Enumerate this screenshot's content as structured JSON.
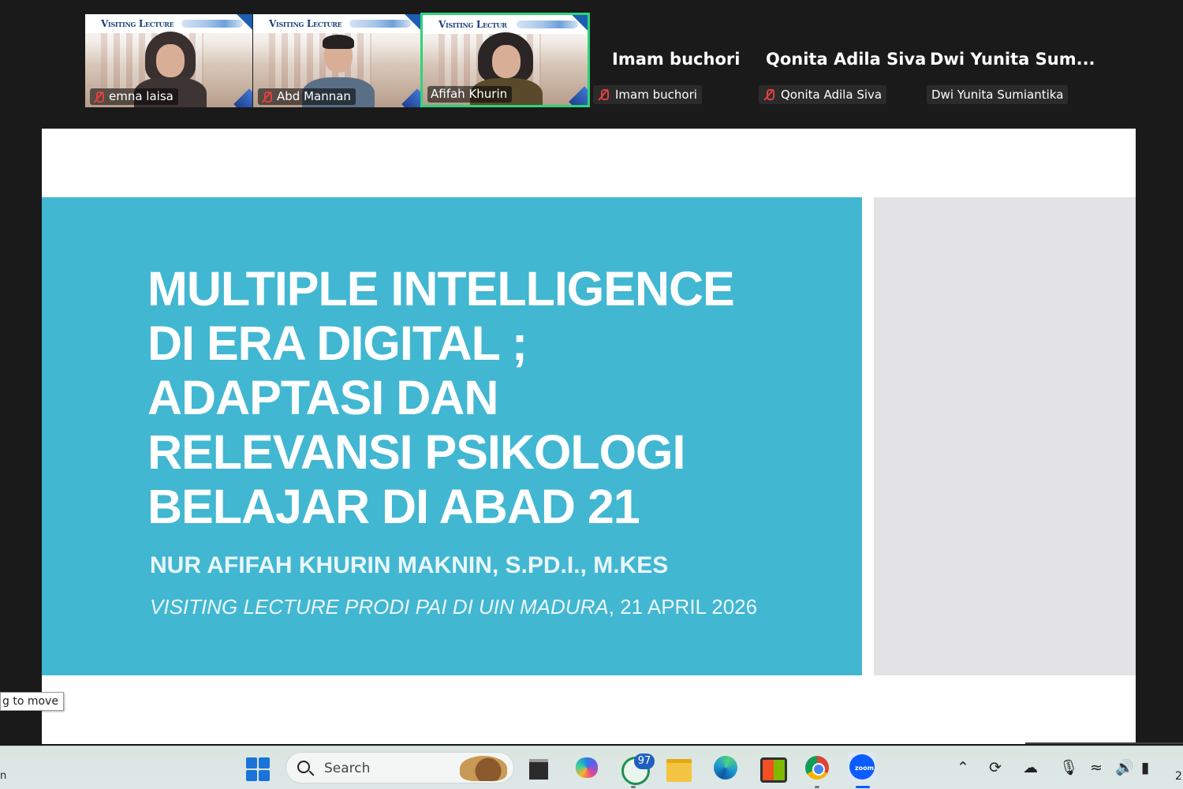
{
  "participants": {
    "video_tiles": [
      {
        "name": "emna laisa",
        "banner": "Visiting Lecture",
        "muted": true,
        "active": false
      },
      {
        "name": "Abd Mannan",
        "banner": "Visiting Lecture",
        "muted": true,
        "active": false
      },
      {
        "name": "Afifah Khurin",
        "banner": "Visiting Lectur",
        "muted": false,
        "active": true
      }
    ],
    "name_tiles": [
      {
        "display": "Imam buchori",
        "label": "Imam buchori",
        "muted": true
      },
      {
        "display": "Qonita Adila Siva",
        "label": "Qonita Adila Siva",
        "muted": true
      },
      {
        "display": "Dwi Yunita Sum...",
        "label": "Dwi Yunita Sumiantika",
        "muted": false
      }
    ]
  },
  "slide": {
    "title_lines": [
      "MULTIPLE INTELLIGENCE",
      "DI ERA DIGITAL ;",
      "ADAPTASI DAN",
      "RELEVANSI PSIKOLOGI",
      "BELAJAR DI ABAD 21"
    ],
    "author": "NUR AFIFAH KHURIN MAKNIN, S.PD.I., M.KES",
    "event_italic": "VISITING LECTURE PRODI PAI DI UIN MADURA",
    "event_date": ", 21 APRIL 2026",
    "colors": {
      "panel": "#42b7d2",
      "side": "#e3e3e6",
      "text": "#ffffff"
    }
  },
  "tooltip": {
    "text": "g to move"
  },
  "taskbar": {
    "search_label": "Search",
    "apps": [
      "start-icon",
      "terminal-icon",
      "copilot-icon",
      "whatsapp-icon",
      "file-explorer-icon",
      "edge-icon",
      "store-icon",
      "chrome-icon",
      "zoom-icon"
    ],
    "whatsapp_badge": "97",
    "zoom_label": "zoom",
    "tray": [
      "chevron-up-icon",
      "sync-icon",
      "cloud-off-icon",
      "microphone-icon",
      "wifi-icon",
      "volume-icon",
      "battery-icon"
    ],
    "clock_fragment": "2",
    "left_fragment": "n"
  },
  "accent": {
    "active_speaker": "#2ed47a",
    "muted": "#e0413f"
  }
}
